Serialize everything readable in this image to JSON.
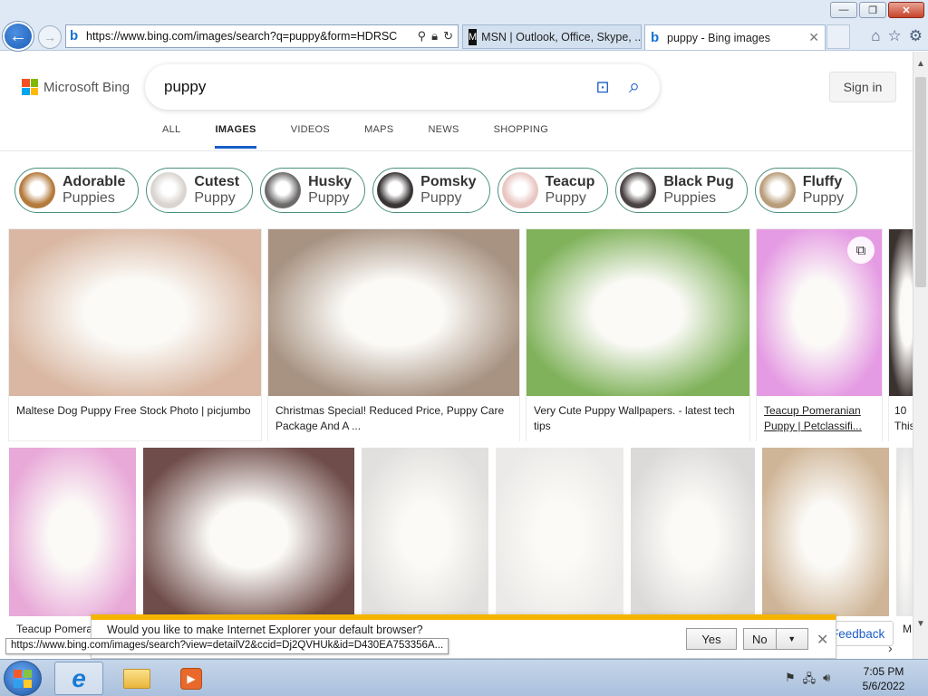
{
  "browser": {
    "address_url": "https://www.bing.com/images/search?q=puppy&form=HDRSC",
    "tabs": [
      {
        "label": "MSN | Outlook, Office, Skype, ..."
      },
      {
        "label": "puppy - Bing images"
      }
    ],
    "window_buttons": {
      "minimize": "—",
      "maximize": "❐",
      "close": "✕"
    }
  },
  "bing": {
    "logo_text": "Microsoft Bing",
    "search_query": "puppy",
    "signin_label": "Sign in",
    "nav_tabs": [
      "ALL",
      "IMAGES",
      "VIDEOS",
      "MAPS",
      "NEWS",
      "SHOPPING"
    ],
    "active_tab": "IMAGES",
    "chips": [
      {
        "line1": "Adorable",
        "line2": "Puppies",
        "color": "#b47a3c"
      },
      {
        "line1": "Cutest",
        "line2": "Puppy",
        "color": "#d9d4cf"
      },
      {
        "line1": "Husky",
        "line2": "Puppy",
        "color": "#6d6a6a"
      },
      {
        "line1": "Pomsky",
        "line2": "Puppy",
        "color": "#3a3535"
      },
      {
        "line1": "Teacup",
        "line2": "Puppy",
        "color": "#e9c6c2"
      },
      {
        "line1": "Black Pug",
        "line2": "Puppies",
        "color": "#4a4242"
      },
      {
        "line1": "Fluffy",
        "line2": "Puppy",
        "color": "#b99d7a"
      }
    ],
    "row1": [
      {
        "caption": "Maltese Dog Puppy Free Stock Photo | picjumbo",
        "color": "#d9b7a2"
      },
      {
        "caption": "Christmas Special! Reduced Price, Puppy Care Package And A ...",
        "color": "#a89382"
      },
      {
        "caption": "Very Cute Puppy Wallpapers. - latest tech tips",
        "color": "#7fb25a"
      },
      {
        "caption": "Teacup Pomeranian Puppy | Petclassifi...",
        "color": "#e59be3"
      },
      {
        "caption": "10 This",
        "color": "#3b3230"
      }
    ],
    "row2": [
      {
        "color": "#e8a8d8"
      },
      {
        "color": "#6f4d4a"
      },
      {
        "color": "#e2e0de"
      },
      {
        "color": "#eceae8"
      },
      {
        "color": "#dcdad9"
      },
      {
        "color": "#cfb597"
      },
      {
        "color": "#e5e5e5"
      }
    ],
    "row3_caption": "Teacup Pomera",
    "row3_right": "M",
    "feedback_label": "Feedback"
  },
  "notification": {
    "message": "Would you like to make Internet Explorer your default browser?",
    "yes_label": "Yes",
    "no_label": "No"
  },
  "status_url": "https://www.bing.com/images/search?view=detailV2&ccid=Dj2QVHUk&id=D430EA753356A...",
  "taskbar": {
    "time": "7:05 PM",
    "date": "5/6/2022"
  }
}
